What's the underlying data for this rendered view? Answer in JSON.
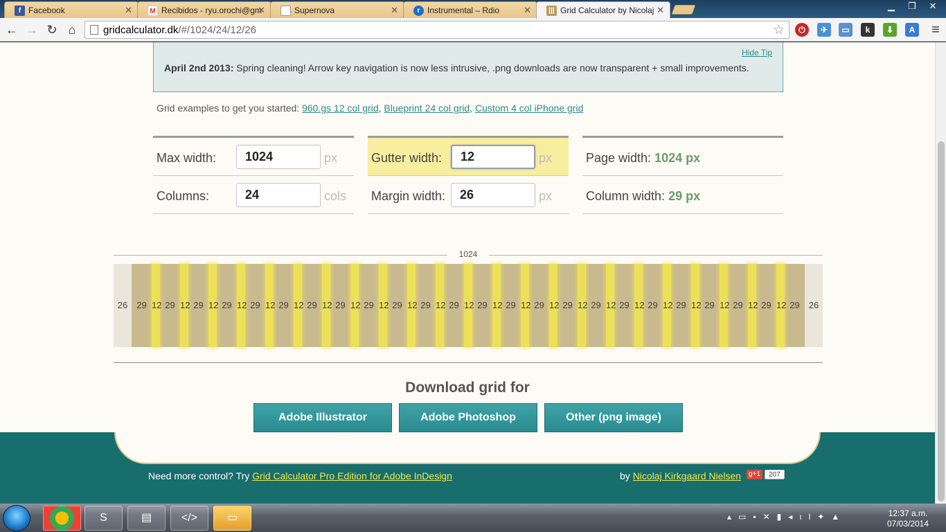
{
  "browser": {
    "tabs": [
      {
        "title": "Facebook",
        "favicon": "facebook-icon",
        "color": "#3b5998",
        "glyph": "f"
      },
      {
        "title": "Recibidos - ryu.orochi@gm",
        "favicon": "gmail-icon",
        "color": "#d93025",
        "glyph": "M"
      },
      {
        "title": "Supernova",
        "favicon": "page-icon",
        "color": "#cccccc",
        "glyph": ""
      },
      {
        "title": "Instrumental – Rdio",
        "favicon": "rdio-icon",
        "color": "#1a6fd0",
        "glyph": "r"
      },
      {
        "title": "Grid Calculator by Nicolaj",
        "favicon": "gridcalc-icon",
        "color": "#b79d62",
        "glyph": "|||"
      }
    ],
    "url_host": "gridcalculator.dk",
    "url_path": "/#/1024/24/12/26"
  },
  "tip": {
    "hide_label": "Hide Tip",
    "date": "April 2nd 2013:",
    "text": " Spring cleaning! Arrow key navigation is now less intrusive, .png downloads are now transparent + small improvements."
  },
  "examples": {
    "intro": "Grid examples to get you started: ",
    "links": [
      "960.gs 12 col grid",
      "Blueprint 24 col grid",
      "Custom 4 col iPhone grid"
    ]
  },
  "form": {
    "max_width_label": "Max width:",
    "max_width": "1024",
    "max_width_unit": "px",
    "columns_label": "Columns:",
    "columns": "24",
    "columns_unit": "cols",
    "gutter_label": "Gutter width:",
    "gutter": "12",
    "gutter_unit": "px",
    "margin_label": "Margin width:",
    "margin": "26",
    "margin_unit": "px",
    "page_width_label": "Page width: ",
    "page_width": "1024 px",
    "column_width_label": "Column width: ",
    "column_width": "29 px"
  },
  "grid": {
    "total": "1024",
    "margin": 26,
    "column": 29,
    "gutter": 12,
    "columns": 24,
    "margin_color": "#ebe6dc",
    "column_color": "#c8ba8e",
    "gutter_color": "#ece059"
  },
  "download": {
    "title": "Download grid for",
    "buttons": [
      "Adobe Illustrator",
      "Adobe Photoshop",
      "Other (png image)"
    ]
  },
  "footer": {
    "left_text": "Need more control? Try ",
    "left_link": "Grid Calculator Pro Edition for Adobe InDesign",
    "by": "by ",
    "author": "Nicolaj Kirkgaard Nielsen",
    "gplus": "g+1",
    "gplus_count": "207"
  },
  "taskbar": {
    "time": "12:37 a.m.",
    "date": "07/03/2014"
  },
  "colors": {
    "accent": "#2c8b8b",
    "result_green": "#6c9a6c",
    "footer_bg": "#186d6d"
  }
}
